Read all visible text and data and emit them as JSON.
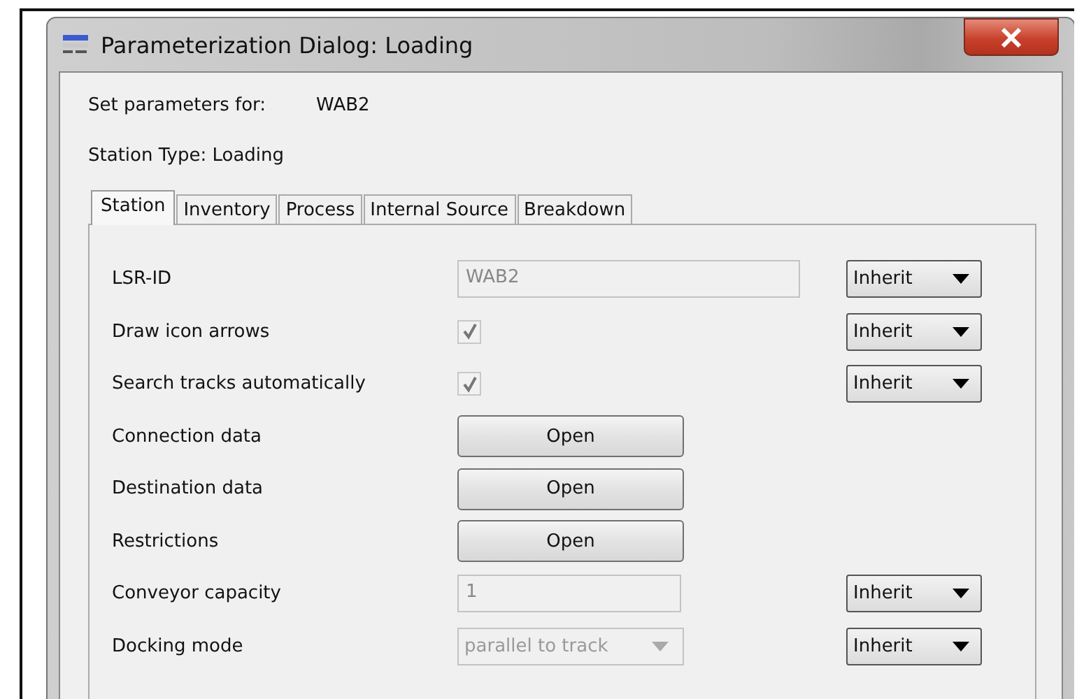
{
  "window": {
    "title": "Parameterization Dialog: Loading"
  },
  "header": {
    "label": "Set parameters for:",
    "value": "WAB2",
    "station_type": "Station Type: Loading"
  },
  "tabs": [
    {
      "label": "Station",
      "selected": true
    },
    {
      "label": "Inventory",
      "selected": false
    },
    {
      "label": "Process",
      "selected": false
    },
    {
      "label": "Internal Source",
      "selected": false
    },
    {
      "label": "Breakdown",
      "selected": false
    }
  ],
  "rows": [
    {
      "label": "LSR-ID",
      "kind": "text",
      "value": "WAB2",
      "inherit": "Inherit"
    },
    {
      "label": "Draw icon arrows",
      "kind": "checkbox",
      "checked": true,
      "inherit": "Inherit"
    },
    {
      "label": "Search tracks automatically",
      "kind": "checkbox",
      "checked": true,
      "inherit": "Inherit"
    },
    {
      "label": "Connection data",
      "kind": "button",
      "button": "Open"
    },
    {
      "label": "Destination data",
      "kind": "button",
      "button": "Open"
    },
    {
      "label": "Restrictions",
      "kind": "button",
      "button": "Open"
    },
    {
      "label": "Conveyor capacity",
      "kind": "number",
      "value": "1",
      "inherit": "Inherit"
    },
    {
      "label": "Docking mode",
      "kind": "select",
      "value": "parallel to track",
      "inherit": "Inherit"
    }
  ]
}
